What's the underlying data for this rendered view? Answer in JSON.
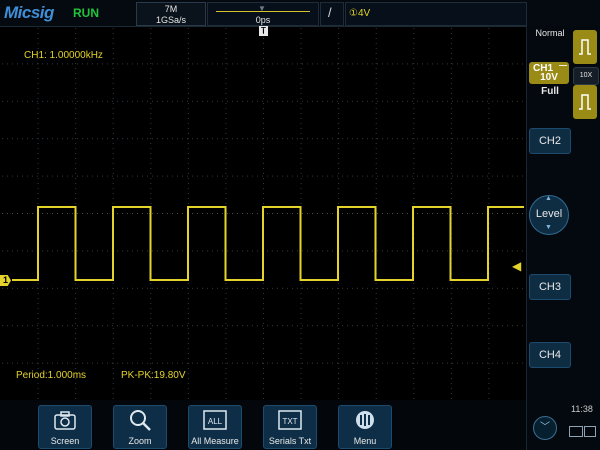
{
  "header": {
    "logo": "Micsig",
    "run_status": "RUN",
    "memory_depth": "7M",
    "sample_rate": "1GSa/s",
    "horizontal_delay": "0ps",
    "trigger_marker": "T",
    "trigger_slope_symbol": "/",
    "trigger_level": "①4V"
  },
  "waveform": {
    "channel_marker": "1",
    "frequency_readout": "CH1: 1.00000kHz",
    "period_readout": "Period:1.000ms",
    "pkpk_readout": "PK-PK:19.80V",
    "signal": {
      "type": "square",
      "period_ms": 1.0,
      "peak_to_peak_v": 19.8,
      "trigger_level_v": 4,
      "color": "#e3d32a"
    }
  },
  "right_panel": {
    "trigger_mode": "Normal",
    "ch1": {
      "name": "CH1",
      "coupling": "—",
      "scale": "10V",
      "bandwidth": "Full",
      "probe": "10X"
    },
    "ch2_label": "CH2",
    "level_label": "Level",
    "ch3_label": "CH3",
    "ch4_label": "CH4",
    "clock": "11:38"
  },
  "toolbar": {
    "screen_label": "Screen",
    "zoom_label": "Zoom",
    "measure_label": "All Measure",
    "measure_icon_text": "ALL",
    "serials_label": "Serials Txt",
    "serials_icon_text": "TXT",
    "menu_label": "Menu"
  },
  "colors": {
    "channel1": "#e3d32a",
    "button": "#0d2e46",
    "logo": "#3f8fd8",
    "run": "#22c33a"
  }
}
